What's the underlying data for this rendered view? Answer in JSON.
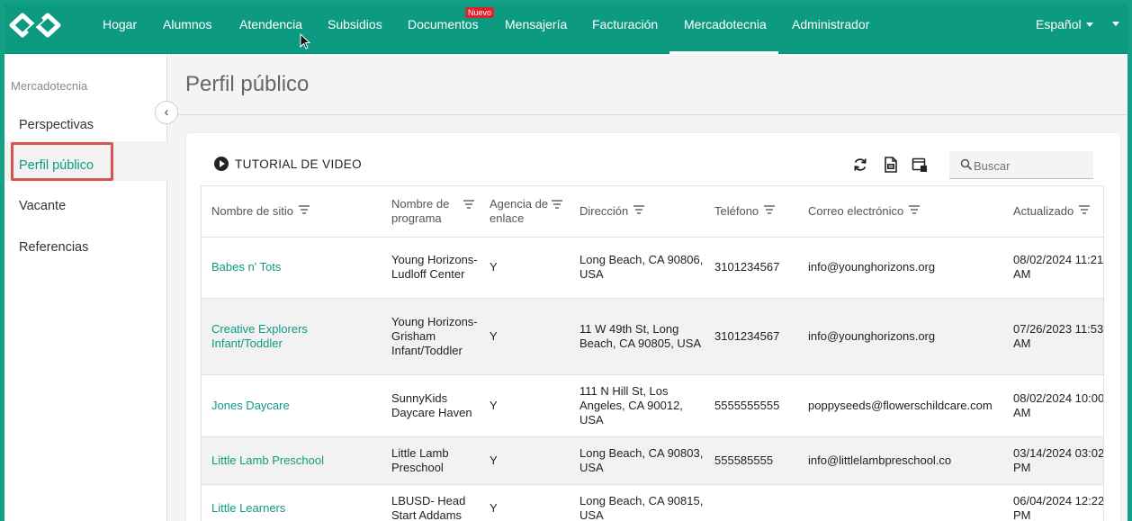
{
  "nav": {
    "items": [
      "Hogar",
      "Alumnos",
      "Atendencia",
      "Subsidios",
      "Documentos",
      "Mensajería",
      "Facturación",
      "Mercadotecnia",
      "Administrador"
    ],
    "new_badge": "Nuevo",
    "language": "Español"
  },
  "sidebar": {
    "title": "Mercadotecnia",
    "items": [
      "Perspectivas",
      "Perfil público",
      "Vacante",
      "Referencias"
    ]
  },
  "page": {
    "title": "Perfil público"
  },
  "toolbar": {
    "tutorial_label": "TUTORIAL DE VIDEO",
    "search_placeholder": "Buscar"
  },
  "table": {
    "headers": [
      "Nombre de sitio",
      "Nombre de programa",
      "Agencia de enlace",
      "Dirección",
      "Teléfono",
      "Correo electrónico",
      "Actualizado"
    ],
    "rows": [
      {
        "site": "Babes n' Tots",
        "program": "Young Horizons- Ludloff Center",
        "agency": "Y",
        "address": "Long Beach, CA 90806, USA",
        "phone": "3101234567",
        "email": "info@younghorizons.org",
        "updated": "08/02/2024 11:21 AM"
      },
      {
        "site": "Creative Explorers Infant/Toddler",
        "program": "Young Horizons- Grisham Infant/Toddler",
        "agency": "Y",
        "address": "11 W 49th St, Long Beach, CA 90805, USA",
        "phone": "3101234567",
        "email": "info@younghorizons.org",
        "updated": "07/26/2023 11:53 AM"
      },
      {
        "site": "Jones Daycare",
        "program": "SunnyKids Daycare Haven",
        "agency": "Y",
        "address": "111 N Hill St, Los Angeles, CA 90012, USA",
        "phone": "5555555555",
        "email": "poppyseeds@flowerschildcare.com",
        "updated": "08/02/2024 10:00 AM"
      },
      {
        "site": "Little Lamb Preschool",
        "program": "Little Lamb Preschool",
        "agency": "Y",
        "address": "Long Beach, CA 90803, USA",
        "phone": "555585555",
        "email": "info@littlelambpreschool.co",
        "updated": "03/14/2024 03:02 PM"
      },
      {
        "site": "Little Learners",
        "program": "LBUSD- Head Start Addams",
        "agency": "Y",
        "address": "Long Beach, CA 90815, USA",
        "phone": "",
        "email": "",
        "updated": "06/04/2024 12:22 PM"
      }
    ]
  },
  "colors": {
    "brand": "#0c9b80",
    "highlight": "#d9534f",
    "badge": "#e0202a"
  }
}
